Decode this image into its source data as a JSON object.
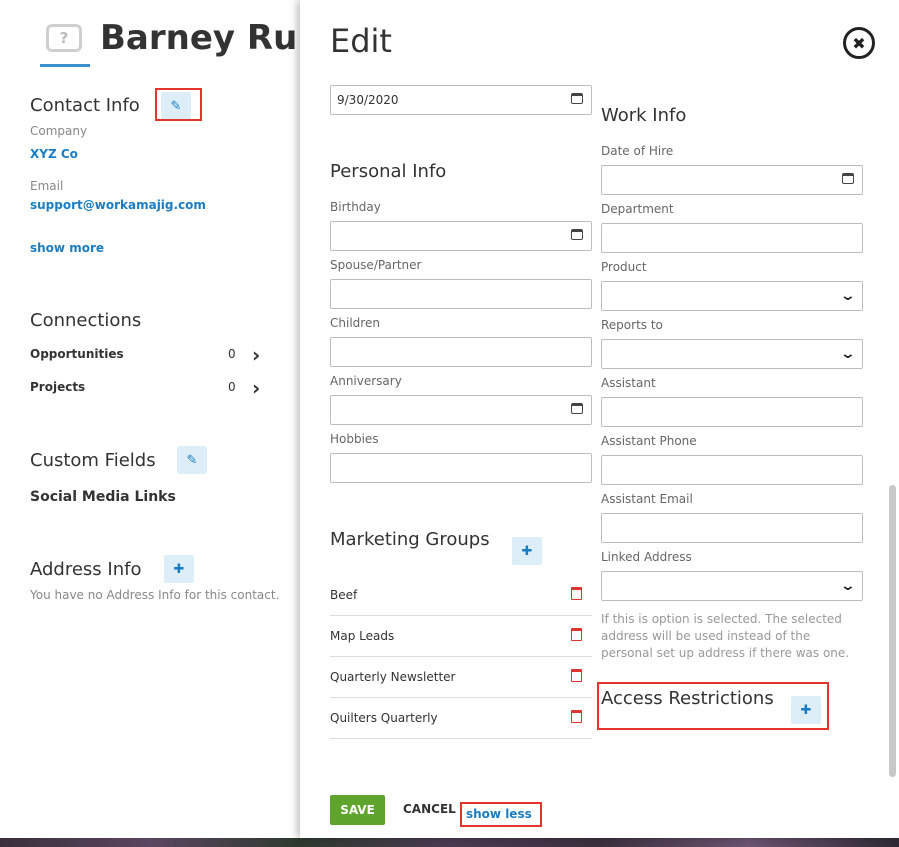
{
  "contact": {
    "name": "Barney Rubb",
    "avatar_glyph": "?",
    "contact_info_title": "Contact Info",
    "company_label": "Company",
    "company_value": "XYZ Co",
    "email_label": "Email",
    "email_value": "support@workamajig.com",
    "show_more": "show more",
    "connections_title": "Connections",
    "connections": [
      {
        "label": "Opportunities",
        "count": "0"
      },
      {
        "label": "Projects",
        "count": "0"
      }
    ],
    "custom_fields_title": "Custom Fields",
    "social_media_links": "Social Media Links",
    "address_info_title": "Address Info",
    "address_empty": "You have no Address Info for this contact."
  },
  "panel": {
    "title": "Edit",
    "top_date_value": "9/30/2020",
    "personal_info_title": "Personal Info",
    "personal_fields": [
      {
        "label": "Birthday",
        "value": "",
        "type": "date"
      },
      {
        "label": "Spouse/Partner",
        "value": "",
        "type": "text"
      },
      {
        "label": "Children",
        "value": "",
        "type": "text"
      },
      {
        "label": "Anniversary",
        "value": "",
        "type": "date"
      },
      {
        "label": "Hobbies",
        "value": "",
        "type": "text"
      }
    ],
    "marketing_groups_title": "Marketing Groups",
    "marketing_groups": [
      "Beef",
      "Map Leads",
      "Quarterly Newsletter",
      "Quilters Quarterly"
    ],
    "work_info_title": "Work Info",
    "work_fields": [
      {
        "label": "Date of Hire",
        "value": "",
        "type": "date"
      },
      {
        "label": "Department",
        "value": "",
        "type": "text"
      },
      {
        "label": "Product",
        "value": "",
        "type": "select"
      },
      {
        "label": "Reports to",
        "value": "",
        "type": "select"
      },
      {
        "label": "Assistant",
        "value": "",
        "type": "text"
      },
      {
        "label": "Assistant Phone",
        "value": "",
        "type": "text"
      },
      {
        "label": "Assistant Email",
        "value": "",
        "type": "text"
      },
      {
        "label": "Linked Address",
        "value": "",
        "type": "select"
      }
    ],
    "linked_address_note": "If this is option is selected. The selected address will be used instead of the personal set up address if there was one.",
    "access_restrictions_title": "Access Restrictions",
    "save_label": "SAVE",
    "cancel_label": "CANCEL",
    "show_less": "show less"
  },
  "colors": {
    "accent_blue": "#1a7dc4",
    "save_green": "#5fa52d",
    "highlight_red": "#e2352b",
    "trash_red": "#d33333"
  },
  "icons": [
    "pencil-icon",
    "plus-icon",
    "chevron-right-icon",
    "calendar-icon",
    "chevron-down-icon",
    "trash-icon",
    "close-icon"
  ]
}
